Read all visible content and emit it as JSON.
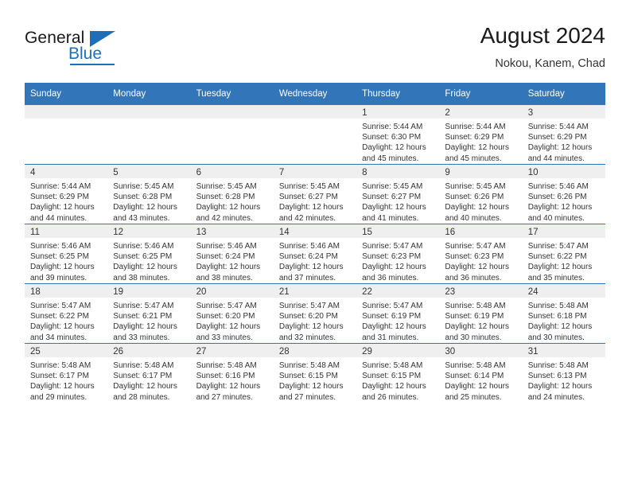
{
  "brand": {
    "name_part1": "General",
    "name_part2": "Blue",
    "logo_icon": "triangle-icon"
  },
  "header": {
    "title": "August 2024",
    "subtitle": "Nokou, Kanem, Chad"
  },
  "calendar": {
    "weekday_headers": [
      "Sunday",
      "Monday",
      "Tuesday",
      "Wednesday",
      "Thursday",
      "Friday",
      "Saturday"
    ],
    "accent_color": "#3275b8",
    "daynum_band_color": "#efefef",
    "weeks": [
      [
        {
          "day": "",
          "empty": true
        },
        {
          "day": "",
          "empty": true
        },
        {
          "day": "",
          "empty": true
        },
        {
          "day": "",
          "empty": true
        },
        {
          "day": "1",
          "sunrise": "Sunrise: 5:44 AM",
          "sunset": "Sunset: 6:30 PM",
          "daylight1": "Daylight: 12 hours",
          "daylight2": "and 45 minutes."
        },
        {
          "day": "2",
          "sunrise": "Sunrise: 5:44 AM",
          "sunset": "Sunset: 6:29 PM",
          "daylight1": "Daylight: 12 hours",
          "daylight2": "and 45 minutes."
        },
        {
          "day": "3",
          "sunrise": "Sunrise: 5:44 AM",
          "sunset": "Sunset: 6:29 PM",
          "daylight1": "Daylight: 12 hours",
          "daylight2": "and 44 minutes."
        }
      ],
      [
        {
          "day": "4",
          "sunrise": "Sunrise: 5:44 AM",
          "sunset": "Sunset: 6:29 PM",
          "daylight1": "Daylight: 12 hours",
          "daylight2": "and 44 minutes."
        },
        {
          "day": "5",
          "sunrise": "Sunrise: 5:45 AM",
          "sunset": "Sunset: 6:28 PM",
          "daylight1": "Daylight: 12 hours",
          "daylight2": "and 43 minutes."
        },
        {
          "day": "6",
          "sunrise": "Sunrise: 5:45 AM",
          "sunset": "Sunset: 6:28 PM",
          "daylight1": "Daylight: 12 hours",
          "daylight2": "and 42 minutes."
        },
        {
          "day": "7",
          "sunrise": "Sunrise: 5:45 AM",
          "sunset": "Sunset: 6:27 PM",
          "daylight1": "Daylight: 12 hours",
          "daylight2": "and 42 minutes."
        },
        {
          "day": "8",
          "sunrise": "Sunrise: 5:45 AM",
          "sunset": "Sunset: 6:27 PM",
          "daylight1": "Daylight: 12 hours",
          "daylight2": "and 41 minutes."
        },
        {
          "day": "9",
          "sunrise": "Sunrise: 5:45 AM",
          "sunset": "Sunset: 6:26 PM",
          "daylight1": "Daylight: 12 hours",
          "daylight2": "and 40 minutes."
        },
        {
          "day": "10",
          "sunrise": "Sunrise: 5:46 AM",
          "sunset": "Sunset: 6:26 PM",
          "daylight1": "Daylight: 12 hours",
          "daylight2": "and 40 minutes."
        }
      ],
      [
        {
          "day": "11",
          "sunrise": "Sunrise: 5:46 AM",
          "sunset": "Sunset: 6:25 PM",
          "daylight1": "Daylight: 12 hours",
          "daylight2": "and 39 minutes."
        },
        {
          "day": "12",
          "sunrise": "Sunrise: 5:46 AM",
          "sunset": "Sunset: 6:25 PM",
          "daylight1": "Daylight: 12 hours",
          "daylight2": "and 38 minutes."
        },
        {
          "day": "13",
          "sunrise": "Sunrise: 5:46 AM",
          "sunset": "Sunset: 6:24 PM",
          "daylight1": "Daylight: 12 hours",
          "daylight2": "and 38 minutes."
        },
        {
          "day": "14",
          "sunrise": "Sunrise: 5:46 AM",
          "sunset": "Sunset: 6:24 PM",
          "daylight1": "Daylight: 12 hours",
          "daylight2": "and 37 minutes."
        },
        {
          "day": "15",
          "sunrise": "Sunrise: 5:47 AM",
          "sunset": "Sunset: 6:23 PM",
          "daylight1": "Daylight: 12 hours",
          "daylight2": "and 36 minutes."
        },
        {
          "day": "16",
          "sunrise": "Sunrise: 5:47 AM",
          "sunset": "Sunset: 6:23 PM",
          "daylight1": "Daylight: 12 hours",
          "daylight2": "and 36 minutes."
        },
        {
          "day": "17",
          "sunrise": "Sunrise: 5:47 AM",
          "sunset": "Sunset: 6:22 PM",
          "daylight1": "Daylight: 12 hours",
          "daylight2": "and 35 minutes."
        }
      ],
      [
        {
          "day": "18",
          "sunrise": "Sunrise: 5:47 AM",
          "sunset": "Sunset: 6:22 PM",
          "daylight1": "Daylight: 12 hours",
          "daylight2": "and 34 minutes."
        },
        {
          "day": "19",
          "sunrise": "Sunrise: 5:47 AM",
          "sunset": "Sunset: 6:21 PM",
          "daylight1": "Daylight: 12 hours",
          "daylight2": "and 33 minutes."
        },
        {
          "day": "20",
          "sunrise": "Sunrise: 5:47 AM",
          "sunset": "Sunset: 6:20 PM",
          "daylight1": "Daylight: 12 hours",
          "daylight2": "and 33 minutes."
        },
        {
          "day": "21",
          "sunrise": "Sunrise: 5:47 AM",
          "sunset": "Sunset: 6:20 PM",
          "daylight1": "Daylight: 12 hours",
          "daylight2": "and 32 minutes."
        },
        {
          "day": "22",
          "sunrise": "Sunrise: 5:47 AM",
          "sunset": "Sunset: 6:19 PM",
          "daylight1": "Daylight: 12 hours",
          "daylight2": "and 31 minutes."
        },
        {
          "day": "23",
          "sunrise": "Sunrise: 5:48 AM",
          "sunset": "Sunset: 6:19 PM",
          "daylight1": "Daylight: 12 hours",
          "daylight2": "and 30 minutes."
        },
        {
          "day": "24",
          "sunrise": "Sunrise: 5:48 AM",
          "sunset": "Sunset: 6:18 PM",
          "daylight1": "Daylight: 12 hours",
          "daylight2": "and 30 minutes."
        }
      ],
      [
        {
          "day": "25",
          "sunrise": "Sunrise: 5:48 AM",
          "sunset": "Sunset: 6:17 PM",
          "daylight1": "Daylight: 12 hours",
          "daylight2": "and 29 minutes."
        },
        {
          "day": "26",
          "sunrise": "Sunrise: 5:48 AM",
          "sunset": "Sunset: 6:17 PM",
          "daylight1": "Daylight: 12 hours",
          "daylight2": "and 28 minutes."
        },
        {
          "day": "27",
          "sunrise": "Sunrise: 5:48 AM",
          "sunset": "Sunset: 6:16 PM",
          "daylight1": "Daylight: 12 hours",
          "daylight2": "and 27 minutes."
        },
        {
          "day": "28",
          "sunrise": "Sunrise: 5:48 AM",
          "sunset": "Sunset: 6:15 PM",
          "daylight1": "Daylight: 12 hours",
          "daylight2": "and 27 minutes."
        },
        {
          "day": "29",
          "sunrise": "Sunrise: 5:48 AM",
          "sunset": "Sunset: 6:15 PM",
          "daylight1": "Daylight: 12 hours",
          "daylight2": "and 26 minutes."
        },
        {
          "day": "30",
          "sunrise": "Sunrise: 5:48 AM",
          "sunset": "Sunset: 6:14 PM",
          "daylight1": "Daylight: 12 hours",
          "daylight2": "and 25 minutes."
        },
        {
          "day": "31",
          "sunrise": "Sunrise: 5:48 AM",
          "sunset": "Sunset: 6:13 PM",
          "daylight1": "Daylight: 12 hours",
          "daylight2": "and 24 minutes."
        }
      ]
    ]
  }
}
